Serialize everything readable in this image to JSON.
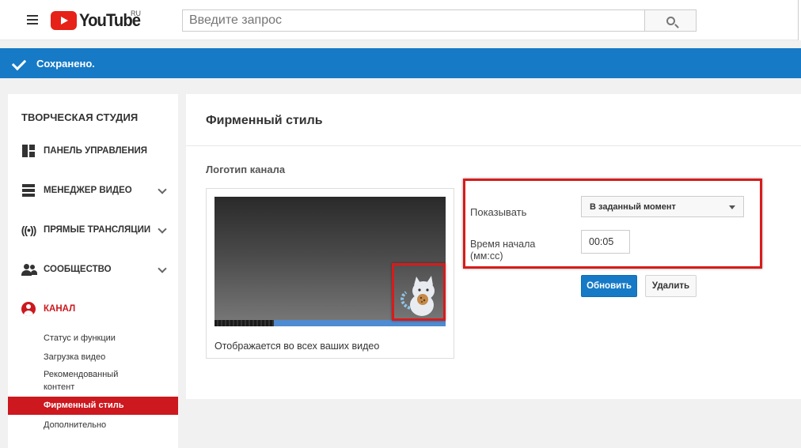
{
  "header": {
    "logo_text": "YouTube",
    "region": "RU",
    "search_placeholder": "Введите запрос"
  },
  "banner": {
    "text": "Сохранено.",
    "color": "#167ac6"
  },
  "sidebar": {
    "title": "ТВОРЧЕСКАЯ СТУДИЯ",
    "items": [
      {
        "label": "ПАНЕЛЬ УПРАВЛЕНИЯ",
        "icon": "dashboard-icon"
      },
      {
        "label": "МЕНЕДЖЕР ВИДЕО",
        "icon": "video-manager-icon"
      },
      {
        "label": "ПРЯМЫЕ ТРАНСЛЯЦИИ",
        "icon": "live-icon"
      },
      {
        "label": "СООБЩЕСТВО",
        "icon": "community-icon"
      },
      {
        "label": "КАНАЛ",
        "icon": "channel-icon"
      }
    ],
    "sub_items": [
      {
        "label": "Статус и функции"
      },
      {
        "label": "Загрузка видео"
      },
      {
        "label": "Рекомендованный контент"
      },
      {
        "label": "Фирменный стиль"
      },
      {
        "label": "Дополнительно"
      }
    ],
    "active_color": "#cc181e"
  },
  "main": {
    "title": "Фирменный стиль",
    "section_title": "Логотип канала",
    "preview_caption": "Отображается во всех ваших видео",
    "show_label": "Показывать",
    "show_value": "В заданный момент",
    "start_label_line1": "Время начала",
    "start_label_line2": "(мм:сс)",
    "start_value": "00:05",
    "update_button": "Обновить",
    "delete_button": "Удалить"
  }
}
